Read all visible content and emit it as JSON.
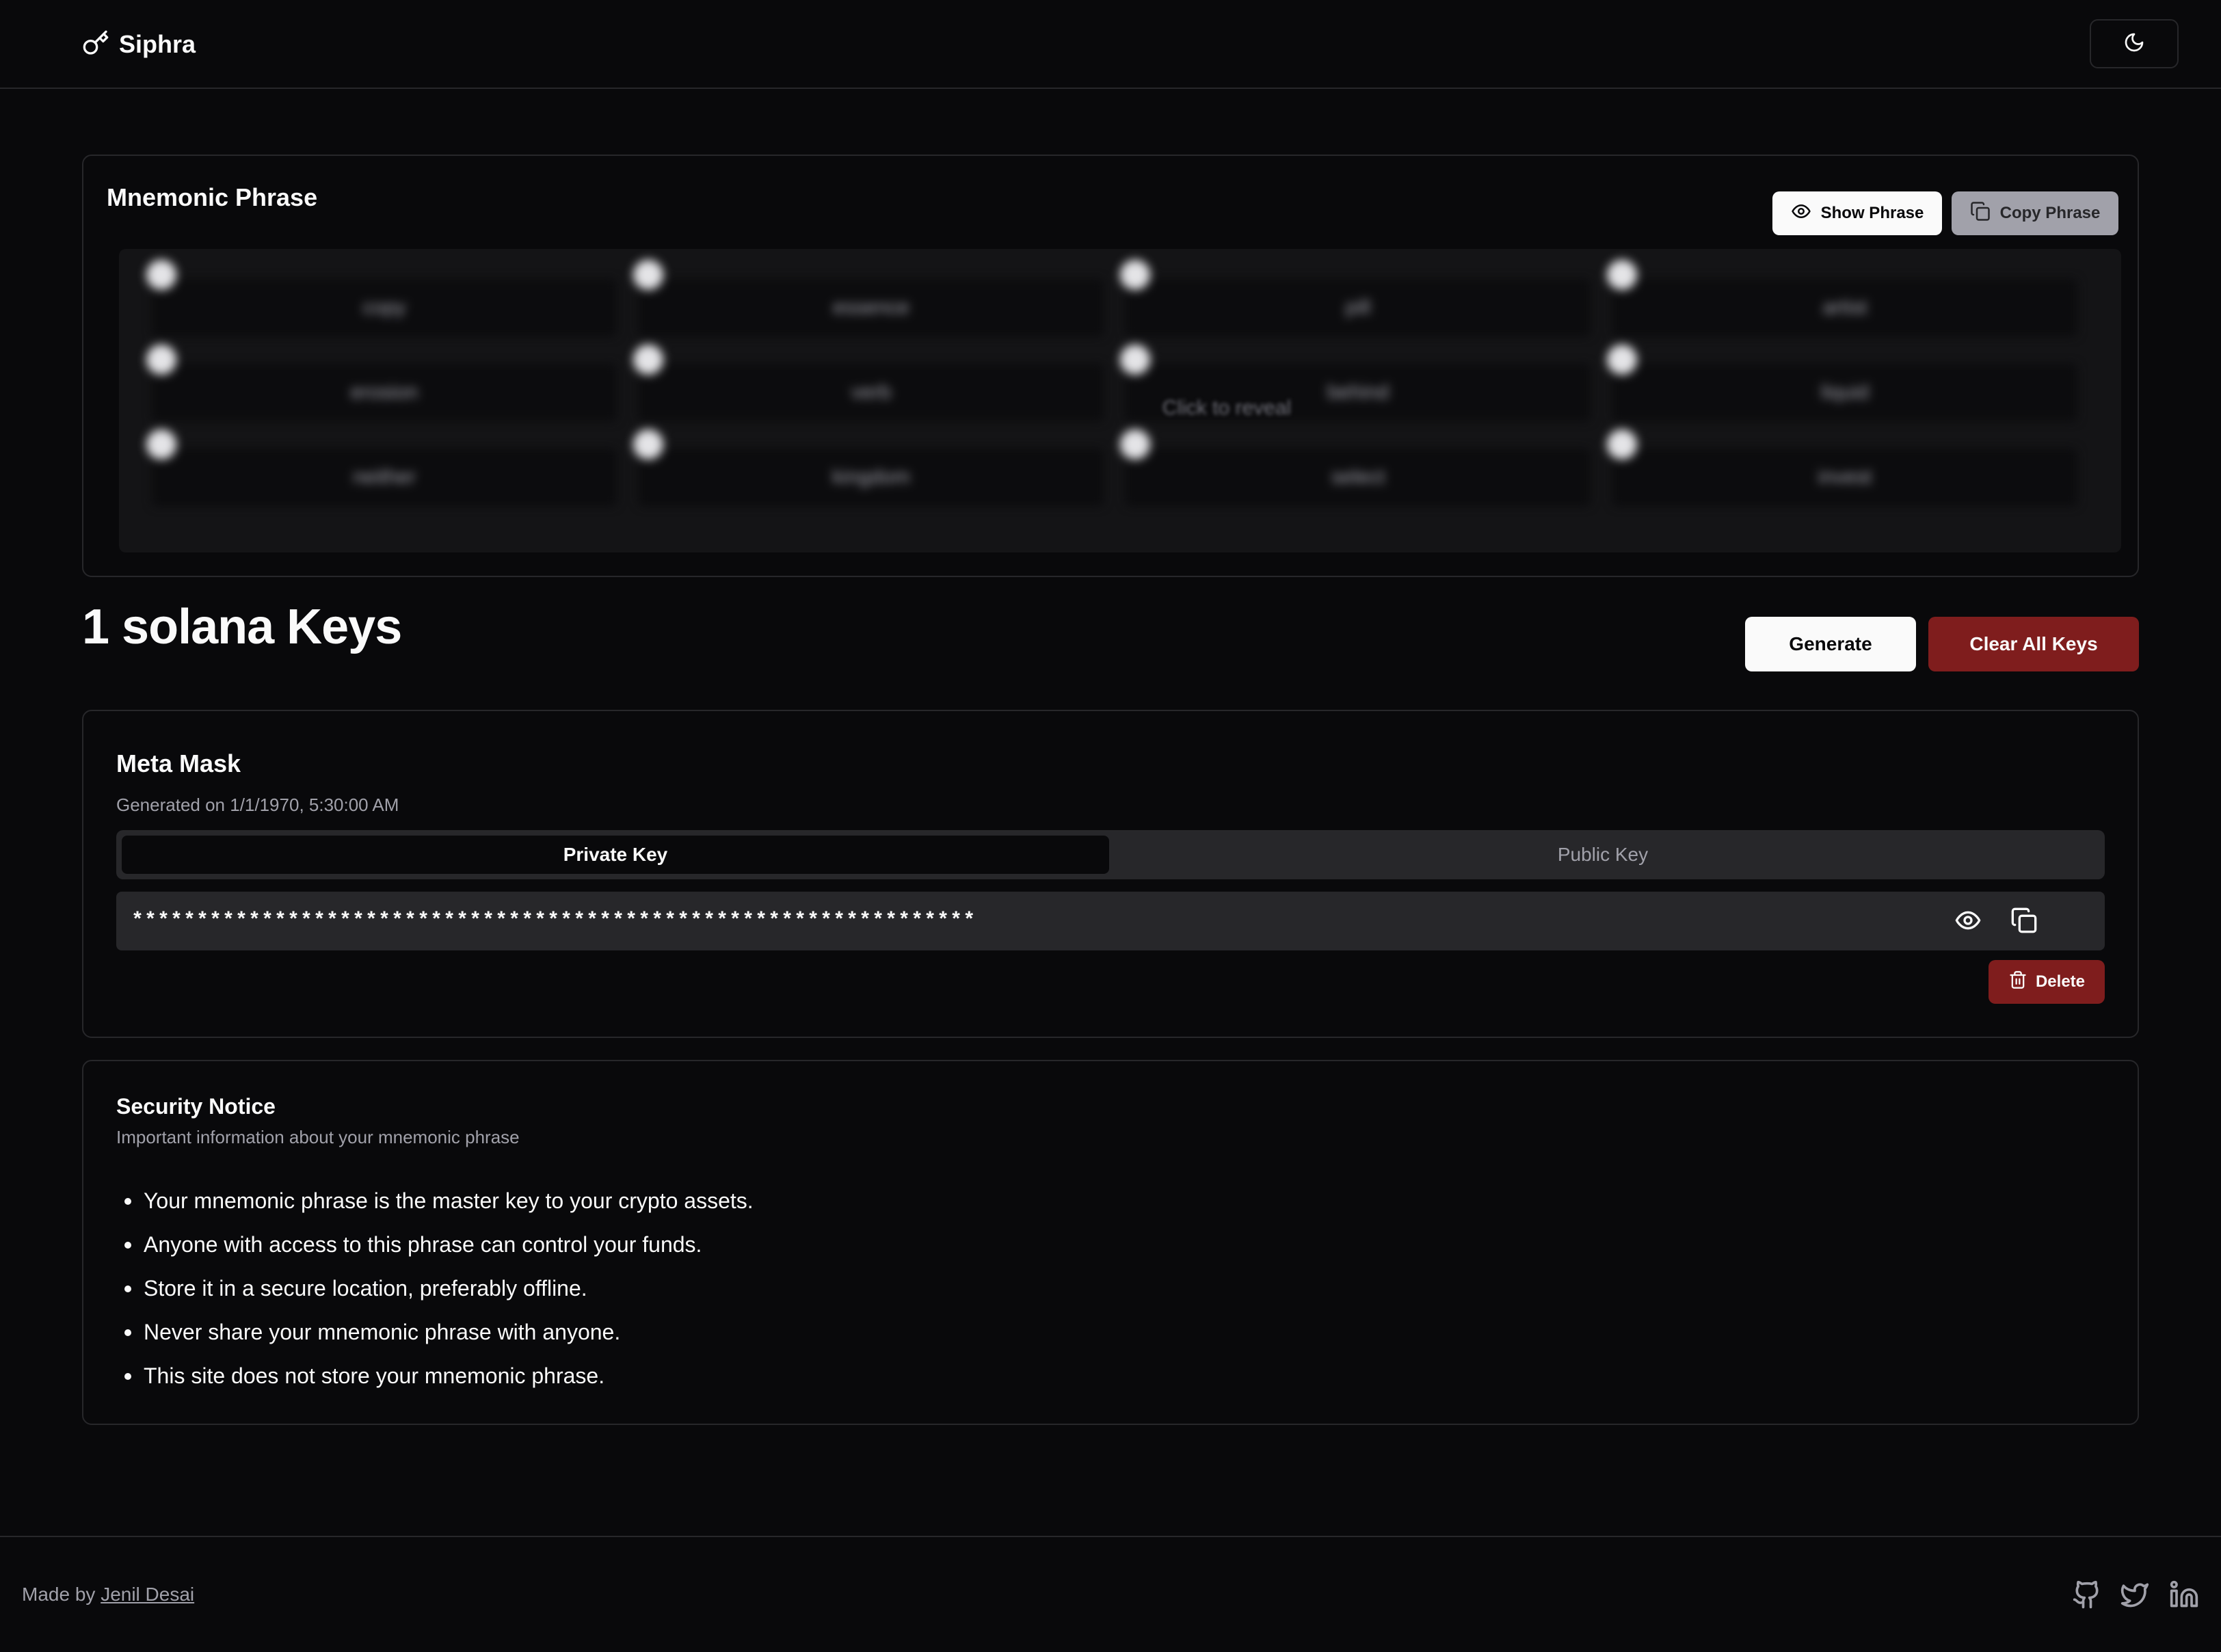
{
  "header": {
    "brand": "Siphra",
    "brand_icon": "key-icon",
    "theme_icon": "moon-icon"
  },
  "mnemonic": {
    "title": "Mnemonic Phrase",
    "show_label": "Show Phrase",
    "copy_label": "Copy Phrase",
    "reveal_hint": "Click to reveal",
    "words": [
      "copy",
      "essence",
      "pill",
      "artist",
      "erosion",
      "verb",
      "behind",
      "liquid",
      "neither",
      "kingdom",
      "select",
      "invest"
    ]
  },
  "keys": {
    "title": "1 solana Keys",
    "generate_label": "Generate",
    "clear_label": "Clear All Keys"
  },
  "wallet": {
    "name": "Meta Mask",
    "generated": "Generated on 1/1/1970, 5:30:00 AM",
    "tabs": [
      "Private Key",
      "Public Key"
    ],
    "active_tab": "Private Key",
    "private_key_masked": "*****************************************************************",
    "delete_label": "Delete"
  },
  "notice": {
    "title": "Security Notice",
    "subtitle": "Important information about your mnemonic phrase",
    "items": [
      "Your mnemonic phrase is the master key to your crypto assets.",
      "Anyone with access to this phrase can control your funds.",
      "Store it in a secure location, preferably offline.",
      "Never share your mnemonic phrase with anyone.",
      "This site does not store your mnemonic phrase."
    ]
  },
  "footer": {
    "made_by": "Made by",
    "author": "Jenil Desai",
    "socials": [
      "github-icon",
      "twitter-icon",
      "linkedin-icon"
    ]
  },
  "colors": {
    "background": "#09090b",
    "border": "#27272a",
    "danger": "#7f1d1d",
    "muted_text": "#a1a1aa"
  }
}
